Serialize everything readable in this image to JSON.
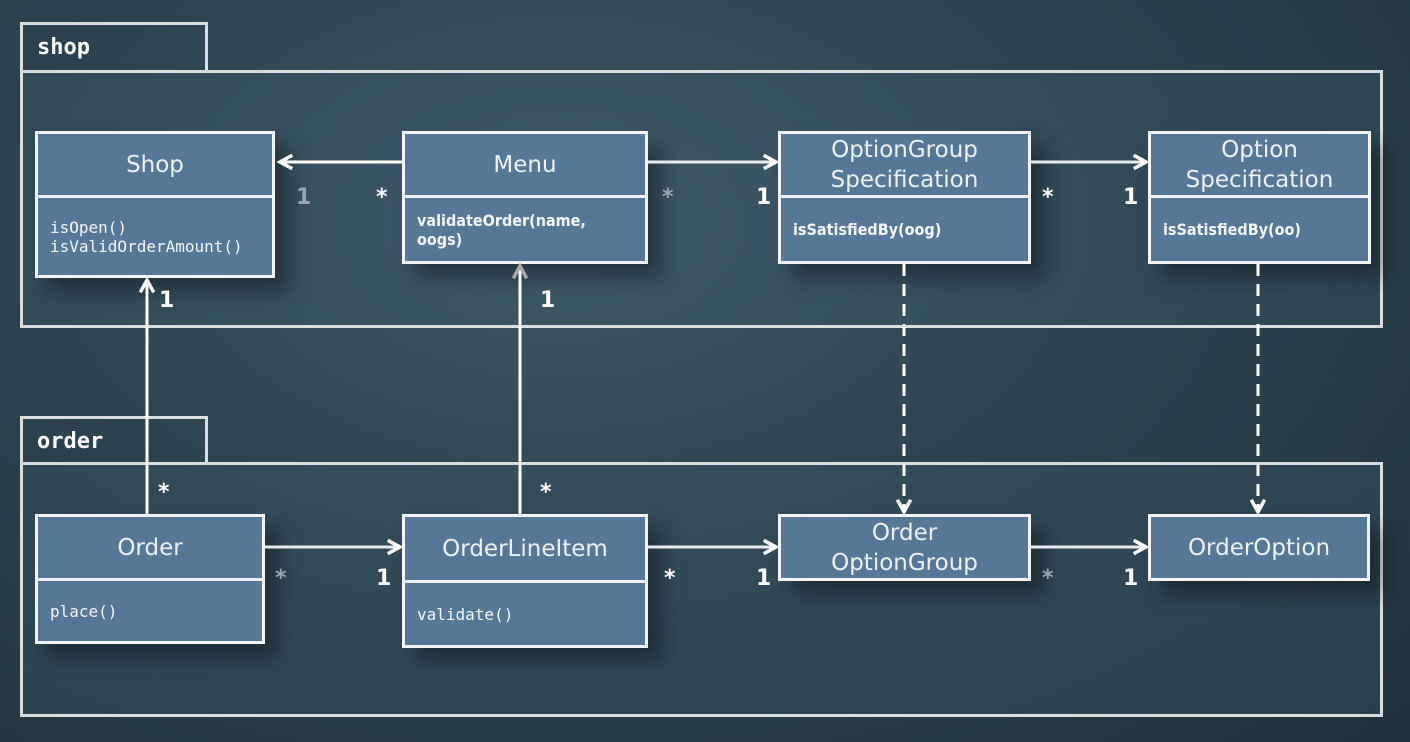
{
  "packages": [
    {
      "id": "shop",
      "label": "shop"
    },
    {
      "id": "order",
      "label": "order"
    }
  ],
  "classes": [
    {
      "id": "shop",
      "name": "Shop",
      "operations": "isOpen()\nisValidOrderAmount()"
    },
    {
      "id": "menu",
      "name": "Menu",
      "operations": "validateOrder(name,\noogs)"
    },
    {
      "id": "option-group-specification",
      "name": "OptionGroup\nSpecification",
      "operations": "isSatisfiedBy(oog)"
    },
    {
      "id": "option-specification",
      "name": "Option\nSpecification",
      "operations": "isSatisfiedBy(oo)"
    },
    {
      "id": "order",
      "name": "Order",
      "operations": "place()"
    },
    {
      "id": "order-line-item",
      "name": "OrderLineItem",
      "operations": "validate()"
    },
    {
      "id": "order-option-group",
      "name": "Order\nOptionGroup",
      "operations": null
    },
    {
      "id": "order-option",
      "name": "OrderOption",
      "operations": null
    }
  ],
  "associations": [
    {
      "from": "menu",
      "to": "shop",
      "from_mult": "*",
      "to_mult": "1",
      "style": "solid"
    },
    {
      "from": "menu",
      "to": "option-group-specification",
      "from_mult": "1",
      "to_mult": "*",
      "style": "solid"
    },
    {
      "from": "option-group-specification",
      "to": "option-specification",
      "from_mult": "1",
      "to_mult": "*",
      "style": "solid"
    },
    {
      "from": "order",
      "to": "shop",
      "from_mult": "*",
      "to_mult": "1",
      "style": "solid"
    },
    {
      "from": "order-line-item",
      "to": "menu",
      "from_mult": "*",
      "to_mult": "1",
      "style": "solid"
    },
    {
      "from": "option-group-specification",
      "to": "order-option-group",
      "style": "dashed"
    },
    {
      "from": "option-specification",
      "to": "order-option",
      "style": "dashed"
    },
    {
      "from": "order",
      "to": "order-line-item",
      "from_mult": "1",
      "to_mult": "*",
      "style": "solid"
    },
    {
      "from": "order-line-item",
      "to": "order-option-group",
      "from_mult": "1",
      "to_mult": "*",
      "style": "solid"
    },
    {
      "from": "order-option-group",
      "to": "order-option",
      "from_mult": "1",
      "to_mult": "*",
      "style": "solid"
    }
  ],
  "colors": {
    "class_fill": "#557899",
    "line": "#ffffff",
    "background": "#2c4450"
  }
}
